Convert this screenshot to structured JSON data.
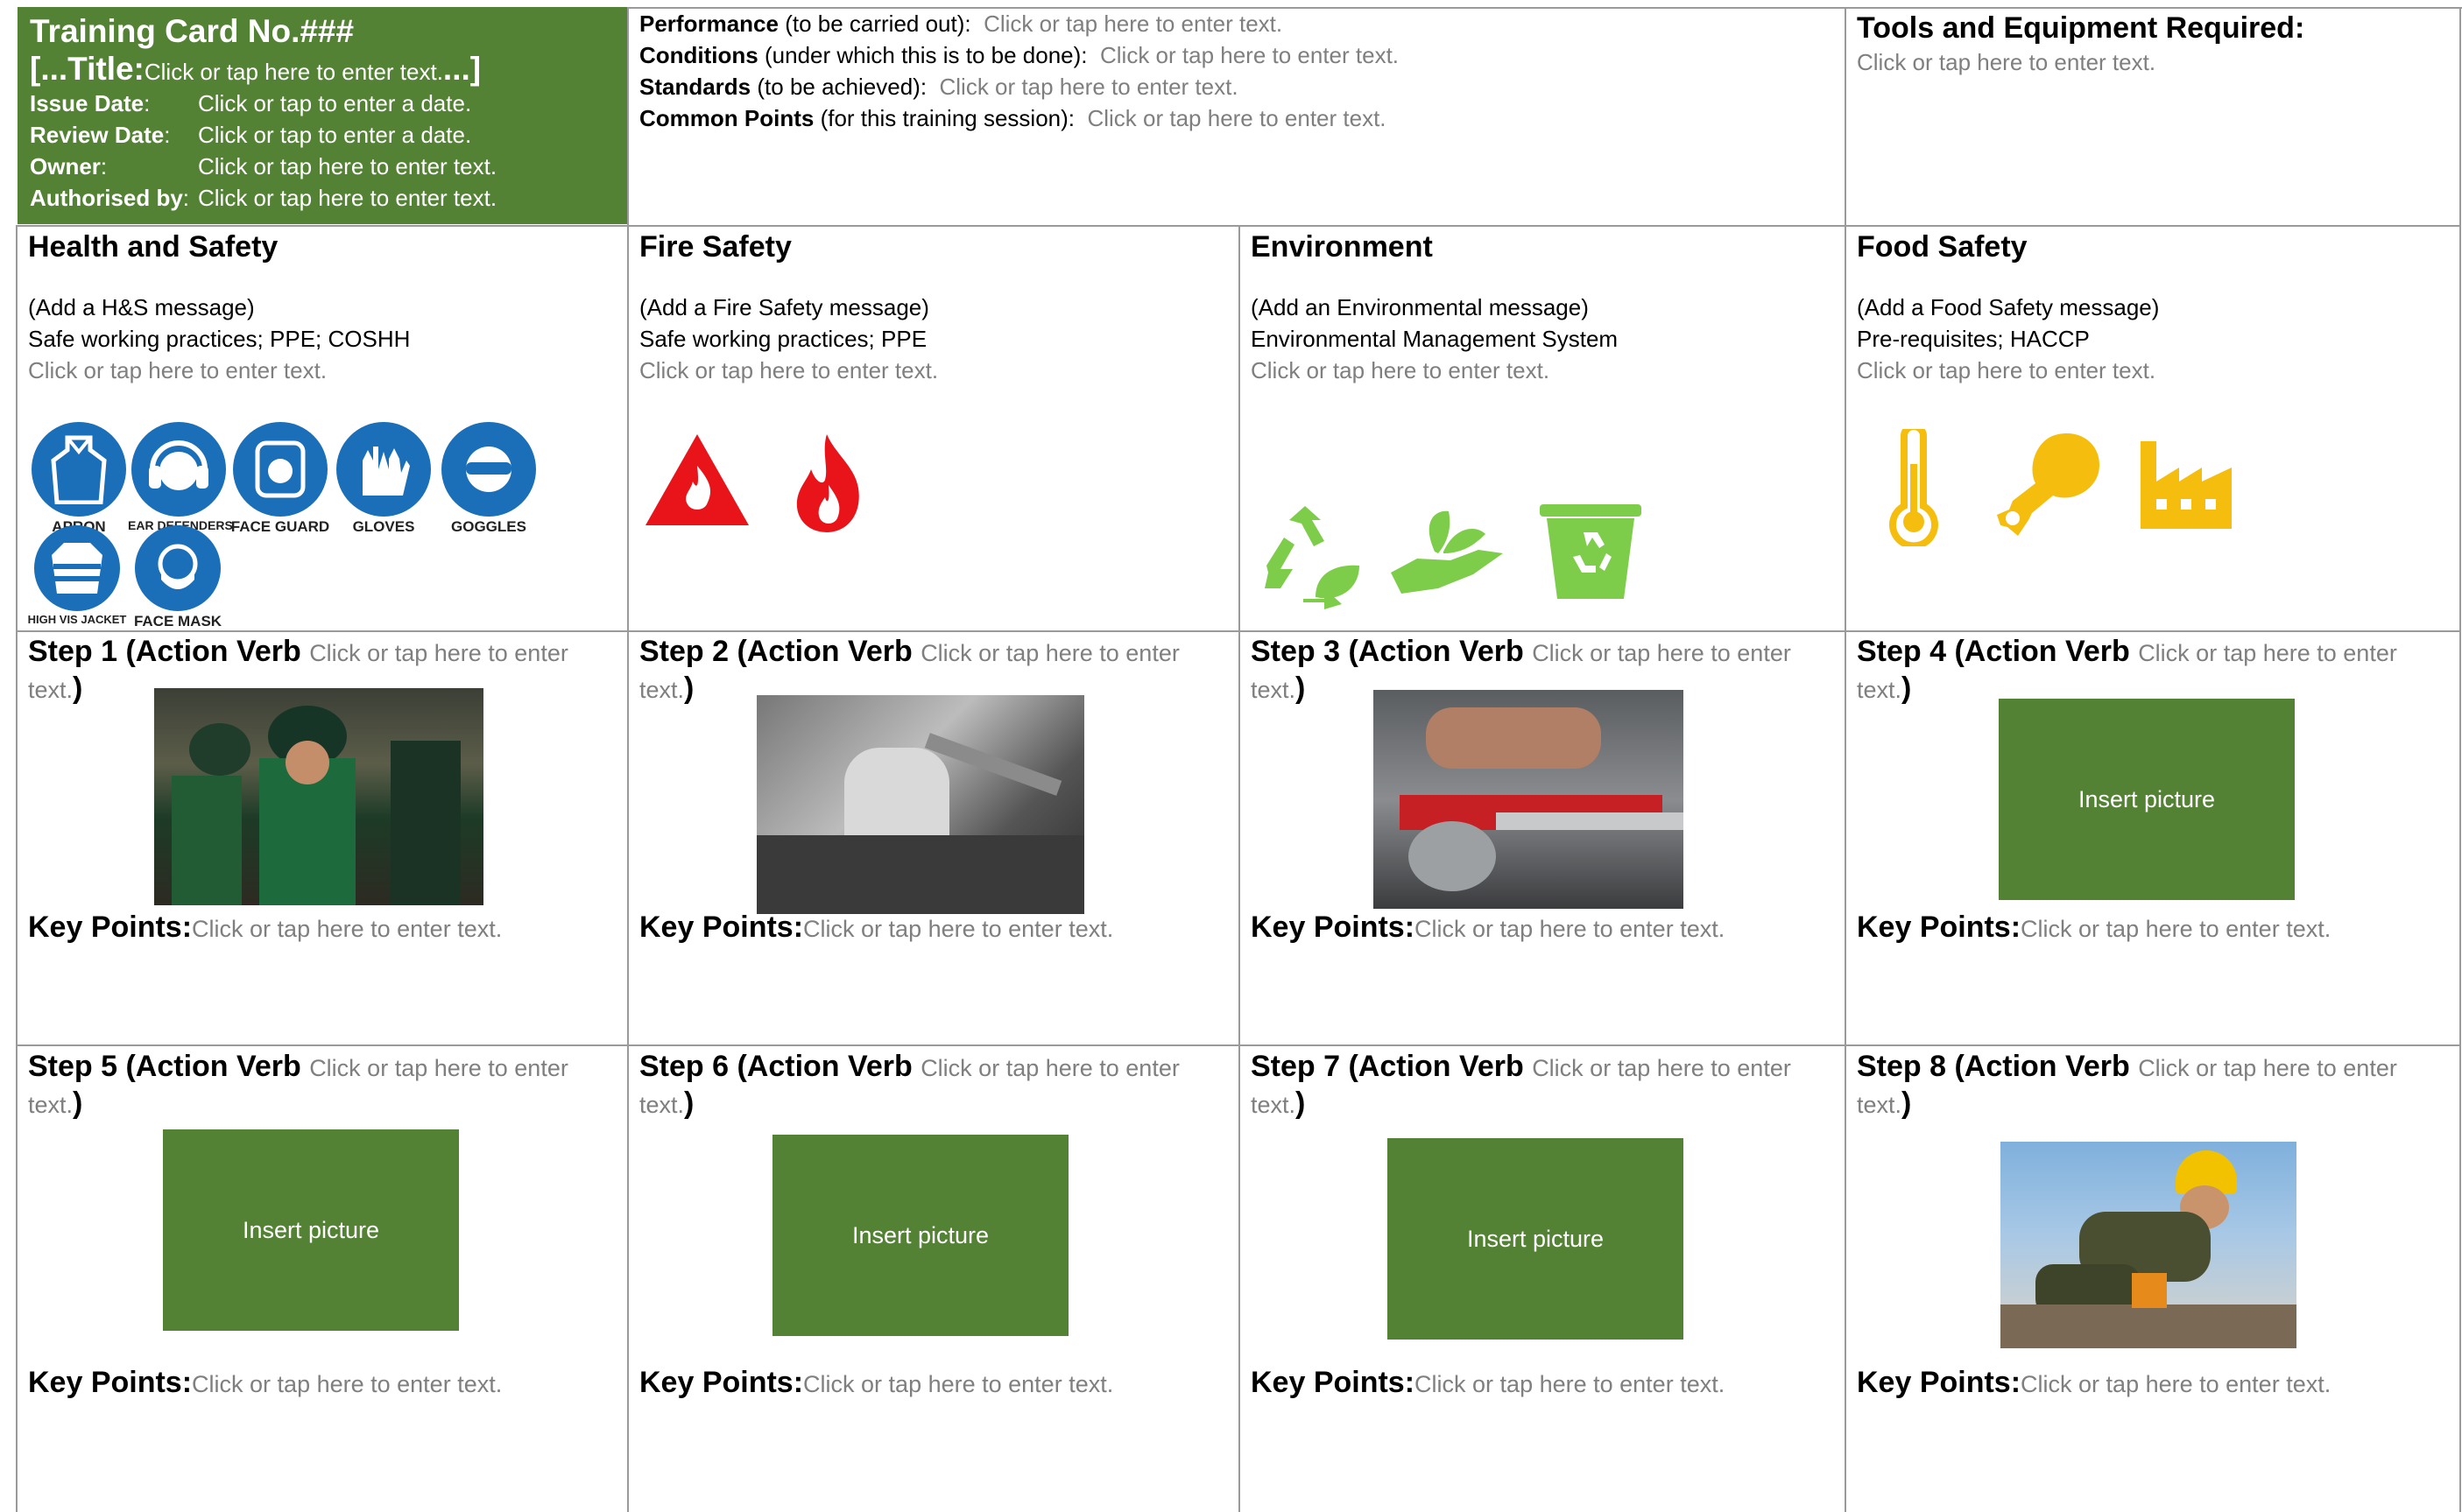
{
  "header": {
    "card_title": "Training Card No.###",
    "title_prefix": "[...Title:",
    "title_placeholder": "Click or tap here to enter text.",
    "title_suffix": "...]",
    "meta": [
      {
        "label": "Issue Date",
        "sep": ":",
        "value": "Click or tap to enter a date."
      },
      {
        "label": "Review Date",
        "sep": ":",
        "value": "Click or tap to enter a date."
      },
      {
        "label": "Owner",
        "sep": ":",
        "value": "Click or tap here to enter text."
      },
      {
        "label": "Authorised by",
        "sep": ":",
        "value": "Click or tap here to enter text."
      }
    ],
    "criteria": [
      {
        "label": "Performance",
        "note": " (to be carried out):",
        "value": "Click or tap here to enter text."
      },
      {
        "label": "Conditions",
        "note": " (under which this is to be done):",
        "value": "Click or tap here to enter text."
      },
      {
        "label": "Standards",
        "note": " (to be achieved):",
        "value": "Click or tap here to enter text."
      },
      {
        "label": "Common Points",
        "note": " (for this training session):",
        "value": "Click or tap here to enter text."
      }
    ],
    "tools": {
      "title": "Tools and Equipment Required:",
      "value": "Click or tap here to enter text."
    }
  },
  "sections": [
    {
      "title": "Health and Safety",
      "line1": "(Add a H&S message)",
      "line2": "Safe working practices; PPE; COSHH",
      "placeholder": "Click or tap here to enter text."
    },
    {
      "title": "Fire Safety",
      "line1": "(Add a Fire Safety message)",
      "line2": "Safe working practices; PPE",
      "placeholder": "Click or tap here to enter text."
    },
    {
      "title": "Environment",
      "line1": "(Add an Environmental message)",
      "line2": "Environmental Management System",
      "placeholder": "Click or tap here to enter text."
    },
    {
      "title": "Food Safety",
      "line1": "(Add a Food Safety message)",
      "line2": "Pre-requisites; HACCP",
      "placeholder": "Click or tap here to enter text."
    }
  ],
  "ppe_icons": [
    {
      "label": "APRON",
      "icon": "apron-icon"
    },
    {
      "label": "EAR DEFENDERS",
      "icon": "ear-defenders-icon"
    },
    {
      "label": "FACE GUARD",
      "icon": "face-guard-icon"
    },
    {
      "label": "GLOVES",
      "icon": "gloves-icon"
    },
    {
      "label": "GOGGLES",
      "icon": "goggles-icon"
    },
    {
      "label": "HIGH VIS JACKET",
      "icon": "high-vis-jacket-icon"
    },
    {
      "label": "FACE MASK",
      "icon": "face-mask-icon"
    }
  ],
  "steps": [
    {
      "title": "Step 1 (Action Verb",
      "placeholder_a": "Click or tap here to enter",
      "placeholder_b": "text.",
      "close": ")",
      "image": "photo"
    },
    {
      "title": "Step 2 (Action Verb",
      "placeholder_a": "Click or tap here to enter",
      "placeholder_b": "text.",
      "close": ")",
      "image": "photo"
    },
    {
      "title": "Step 3 (Action Verb",
      "placeholder_a": "Click or tap here to enter",
      "placeholder_b": "text.",
      "close": ")",
      "image": "photo"
    },
    {
      "title": "Step 4 (Action Verb",
      "placeholder_a": "Click or tap here to enter",
      "placeholder_b": "text.",
      "close": ")",
      "image": "Insert picture"
    },
    {
      "title": "Step 5 (Action Verb",
      "placeholder_a": "Click or tap here to enter",
      "placeholder_b": "text.",
      "close": ")",
      "image": "Insert picture"
    },
    {
      "title": "Step 6 (Action Verb",
      "placeholder_a": "Click or tap here to enter",
      "placeholder_b": "text.",
      "close": ")",
      "image": "Insert picture"
    },
    {
      "title": "Step 7 (Action Verb",
      "placeholder_a": "Click or tap here to enter",
      "placeholder_b": "text.",
      "close": ")",
      "image": "Insert picture"
    },
    {
      "title": "Step 8 (Action Verb",
      "placeholder_a": "Click or tap here to enter",
      "placeholder_b": "text.",
      "close": ")",
      "image": "photo"
    }
  ],
  "key_points": {
    "label": "Key Points:",
    "placeholder": "Click or tap here to enter text."
  },
  "colors": {
    "green": "#548235",
    "fire_red": "#e8141a",
    "env_green": "#7dcc4a",
    "food_yellow": "#f5be0e",
    "ppe_blue": "#1a6fb8"
  }
}
